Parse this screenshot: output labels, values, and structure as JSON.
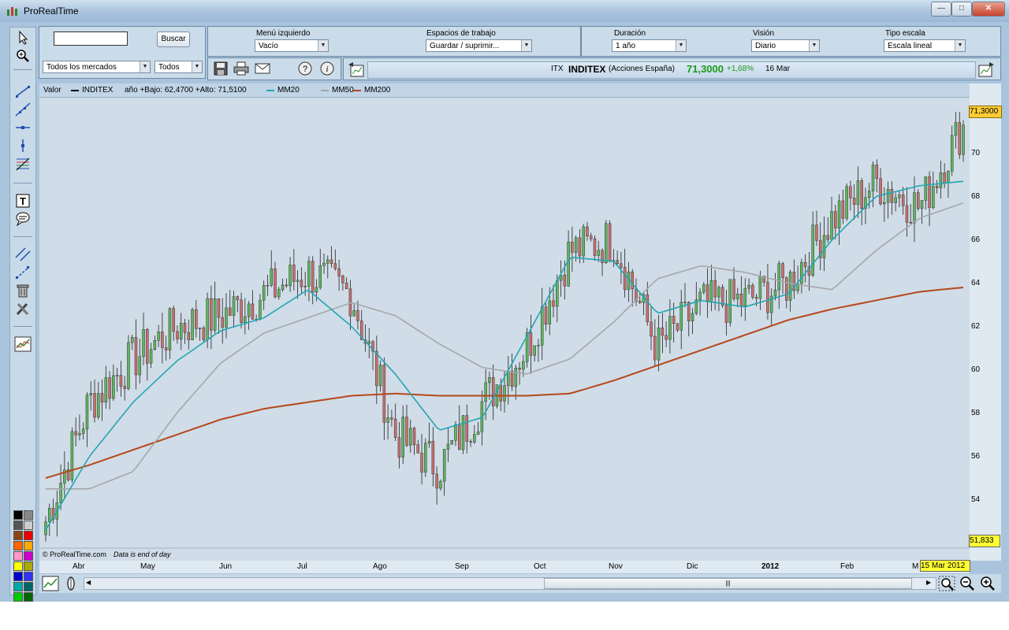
{
  "window": {
    "title": "ProRealTime",
    "controls": [
      "—",
      "□",
      "✕"
    ]
  },
  "search_panel": {
    "search_value": "",
    "search_button": "Buscar",
    "market_select": "Todos los mercados",
    "type_select": "Todos"
  },
  "settings": {
    "left_menu_label": "Menú izquierdo",
    "left_menu_value": "Vacío",
    "workspaces_label": "Espacios de trabajo",
    "workspaces_value": "Guardar / suprimir...",
    "duration_label": "Duración",
    "duration_value": "1 año",
    "view_label": "Visión",
    "view_value": "Diario",
    "scale_label": "Tipo escala",
    "scale_value": "Escala lineal"
  },
  "toolbar_icons": [
    "save-icon",
    "print-icon",
    "mail-icon",
    "help-icon",
    "info-icon"
  ],
  "info_bar": {
    "code": "ITX",
    "name": "INDITEX",
    "market": "(Acciones España)",
    "price": "71,3000",
    "change": "+1,68%",
    "date": "16 Mar"
  },
  "legend": {
    "valor": "Valor",
    "instrument": "INDITEX",
    "range_text": "año +Bajo: 62,4700 +Alto: 71,5100",
    "mm20": "MM20",
    "mm50": "MM50",
    "mm200": "MM200"
  },
  "colors": {
    "up": "#5cb85c",
    "down": "#c8706e",
    "mm20": "#21a7b3",
    "mm50": "#a7a7a7",
    "mm200": "#b5481a",
    "chart_bg": "#d0dce7",
    "price_tag": "#ffd700"
  },
  "footer": {
    "copyright": "© ProRealTime.com",
    "note": "Data is end of day"
  },
  "price_tags": {
    "last": "71,3000",
    "low": "51,833"
  },
  "cursor_date": "15 Mar 2012",
  "chart_data": {
    "type": "candlestick",
    "instrument": "INDITEX",
    "yticks": [
      54,
      56,
      58,
      60,
      62,
      64,
      66,
      68,
      70
    ],
    "ylim": [
      52.2,
      72.2
    ],
    "xticks": [
      "Abr",
      "May",
      "Jun",
      "Jul",
      "Ago",
      "Sep",
      "Oct",
      "Nov",
      "Dic",
      "2012",
      "Feb",
      "M"
    ],
    "last_price": 71.3,
    "low_marker": 51.833,
    "mm200": [
      55.0,
      55.6,
      56.3,
      57.0,
      57.7,
      58.2,
      58.5,
      58.8,
      58.9,
      58.8,
      58.8,
      58.8,
      58.9,
      59.5,
      60.2,
      60.9,
      61.6,
      62.3,
      62.8,
      63.2,
      63.6,
      63.8
    ],
    "mm50": [
      54.5,
      54.5,
      55.3,
      58.0,
      60.3,
      61.7,
      62.4,
      63.1,
      62.5,
      61.2,
      60.1,
      59.8,
      60.5,
      62.2,
      64.2,
      64.8,
      64.5,
      64.0,
      63.7,
      65.5,
      67.0,
      67.7
    ],
    "mm20": [
      52.6,
      56.0,
      58.5,
      60.4,
      61.8,
      62.4,
      63.7,
      62.0,
      59.8,
      57.2,
      57.8,
      61.5,
      65.2,
      65.0,
      62.6,
      63.2,
      62.9,
      63.5,
      66.0,
      68.0,
      68.5,
      68.7
    ],
    "closes": [
      53.0,
      58.5,
      60.5,
      62.0,
      62.5,
      63.5,
      64.5,
      63.5,
      57.0,
      55.5,
      58.5,
      61.0,
      65.5,
      66.0,
      61.0,
      63.0,
      63.2,
      64.0,
      67.0,
      68.7,
      67.5,
      71.3
    ]
  }
}
